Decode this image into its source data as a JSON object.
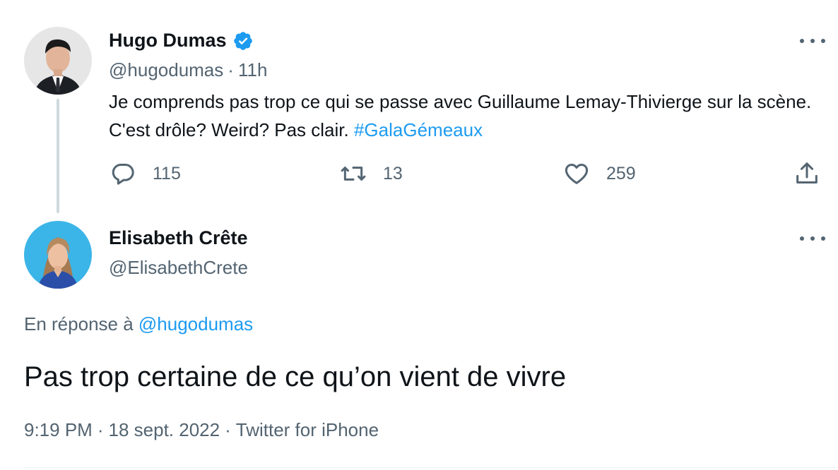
{
  "parent_tweet": {
    "author_name": "Hugo Dumas",
    "verified": true,
    "handle": "@hugodumas",
    "separator": "·",
    "time_ago": "11h",
    "text": "Je comprends pas trop ce qui se passe avec Guillaume Lemay-Thivierge sur la scène. C'est drôle? Weird? Pas clair. ",
    "hashtag": "#GalaGémeaux",
    "replies": "115",
    "retweets": "13",
    "likes": "259"
  },
  "reply_tweet": {
    "author_name": "Elisabeth Crête",
    "handle": "@ElisabethCrete",
    "reply_prefix": "En réponse à ",
    "reply_mention": "@hugodumas",
    "text": "Pas trop certaine de ce qu’on vient de vivre",
    "time": "9:19 PM",
    "separator": "·",
    "date": "18 sept. 2022",
    "source": "Twitter for iPhone"
  },
  "colors": {
    "accent": "#1d9bf0",
    "secondary_text": "#536471",
    "primary_text": "#0f1419",
    "thread_line": "#cfd9de"
  },
  "icons": [
    "verified-badge-icon",
    "more-icon",
    "reply-icon",
    "retweet-icon",
    "like-icon",
    "share-icon"
  ]
}
